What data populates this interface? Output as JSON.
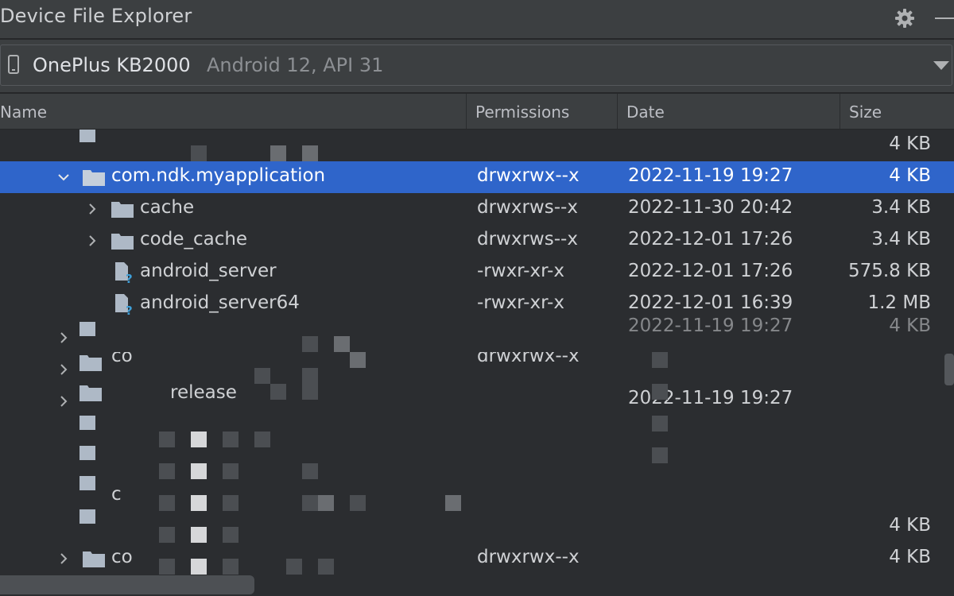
{
  "window": {
    "title": "Device File Explorer",
    "icons": [
      "gear-icon",
      "minimize-icon"
    ]
  },
  "device": {
    "name": "OnePlus KB2000",
    "api": "Android 12, API 31"
  },
  "columns": {
    "name": "Name",
    "permissions": "Permissions",
    "date": "Date",
    "size": "Size"
  },
  "rows": [
    {
      "name": "",
      "permissions": "",
      "date": "",
      "size": "4 KB",
      "type": "folder",
      "expanded": false
    },
    {
      "name": "com.ndk.myapplication",
      "permissions": "drwxrwx--x",
      "date": "2022-11-19 19:27",
      "size": "4 KB",
      "type": "folder",
      "expanded": true,
      "selected": true
    },
    {
      "name": "cache",
      "permissions": "drwxrws--x",
      "date": "2022-11-30 20:42",
      "size": "3.4 KB",
      "type": "folder",
      "expanded": false
    },
    {
      "name": "code_cache",
      "permissions": "drwxrws--x",
      "date": "2022-12-01 17:26",
      "size": "3.4 KB",
      "type": "folder",
      "expanded": false
    },
    {
      "name": "android_server",
      "permissions": "-rwxr-xr-x",
      "date": "2022-12-01 17:26",
      "size": "575.8 KB",
      "type": "unknown-file"
    },
    {
      "name": "android_server64",
      "permissions": "-rwxr-xr-x",
      "date": "2022-12-01 16:39",
      "size": "1.2 MB",
      "type": "unknown-file"
    },
    {
      "name": "",
      "permissions": "",
      "date": "2022-11-19 19:27",
      "size": "4 KB",
      "type": "folder",
      "obscured": true
    },
    {
      "name": "co",
      "permissions": "drwxrwx--x",
      "date": "",
      "size": "",
      "type": "folder",
      "obscured": true
    },
    {
      "name": "release",
      "permissions": "",
      "date": "2022-11-19 19:27",
      "size": "",
      "type": "folder",
      "obscured": true
    },
    {
      "name": "",
      "permissions": "",
      "date": "",
      "size": "",
      "type": "folder",
      "obscured": true
    },
    {
      "name": "",
      "permissions": "",
      "date": "",
      "size": "",
      "type": "folder",
      "obscured": true
    },
    {
      "name": "c",
      "permissions": "",
      "date": "",
      "size": "",
      "type": "folder",
      "obscured": true
    },
    {
      "name": "",
      "permissions": "",
      "date": "",
      "size": "4 KB",
      "type": "folder",
      "obscured": true
    },
    {
      "name": "co",
      "permissions": "drwxrwx--x",
      "date": "",
      "size": "4 KB",
      "type": "folder",
      "obscured": true
    }
  ],
  "colors": {
    "background": "#2b2d30",
    "panel": "#3c3f41",
    "selection": "#2f65ca",
    "folder": "#aeb9c6",
    "help_badge": "#3e9fd8"
  }
}
